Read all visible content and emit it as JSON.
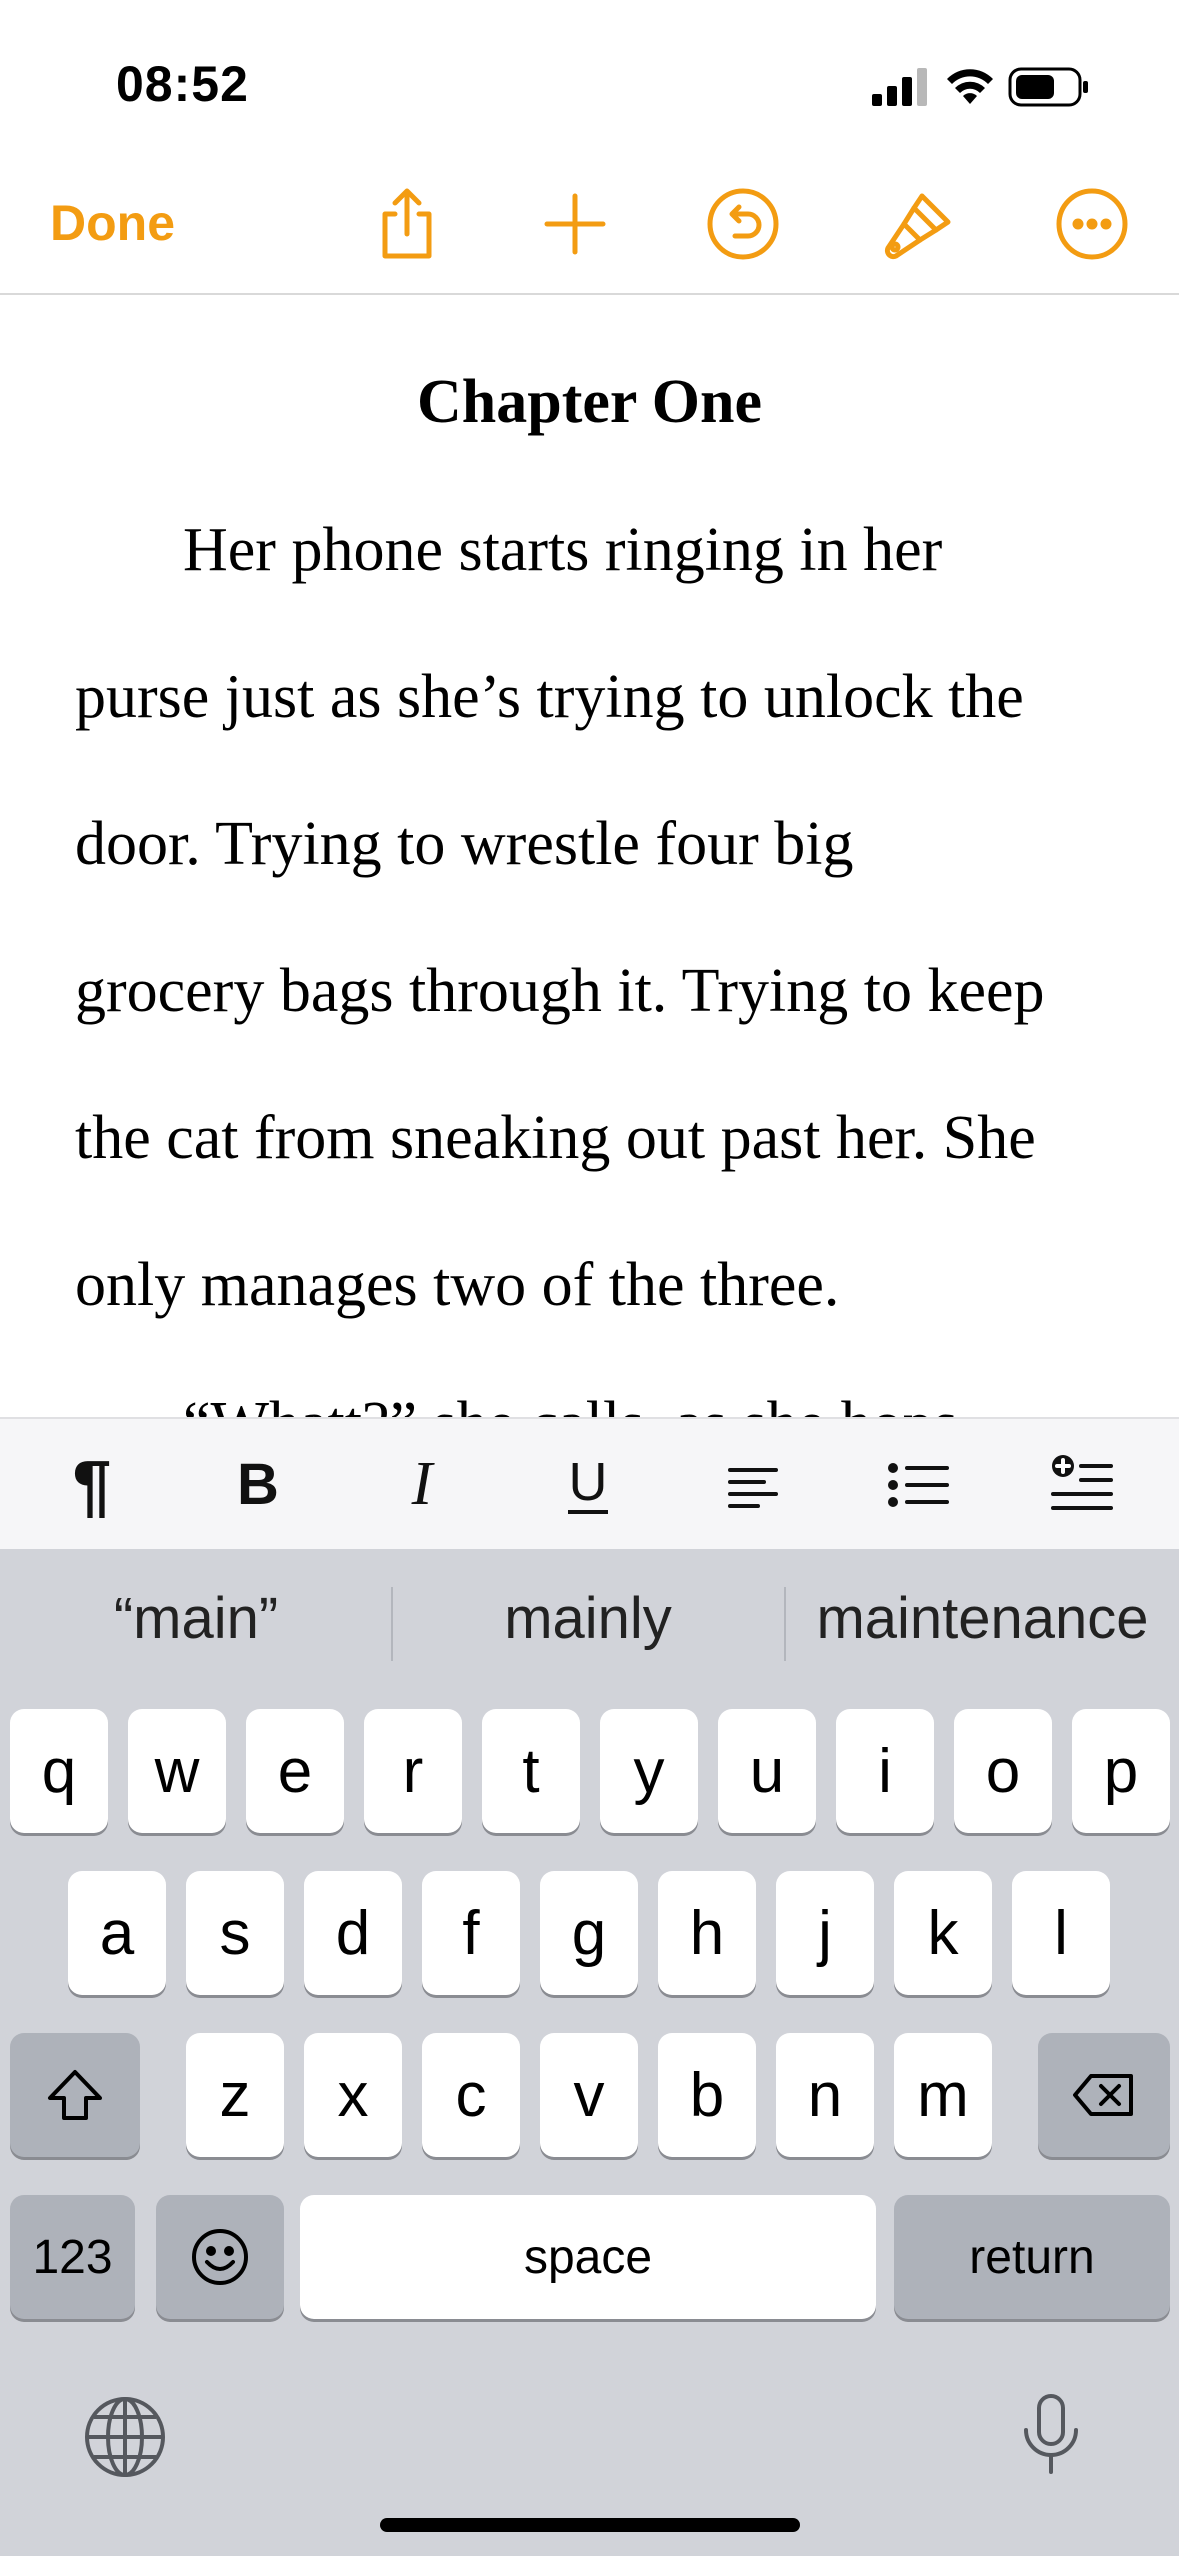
{
  "status_bar": {
    "time": "08:52"
  },
  "toolbar": {
    "done_label": "Done"
  },
  "document": {
    "title": "Chapter One",
    "lines": [
      "Her phone starts ringing in her",
      "purse just as she’s trying to unlock the",
      "door. Trying to wrestle four big",
      "grocery bags through it. Trying to keep",
      "the cat from sneaking out past her. She",
      "only manages two of the three.",
      "“Whatt?” she calls, as she hops"
    ]
  },
  "format_bar": {
    "paragraph_symbol": "¶"
  },
  "keyboard": {
    "predictions": [
      "“main”",
      "mainly",
      "maintenance"
    ],
    "row1": [
      "q",
      "w",
      "e",
      "r",
      "t",
      "y",
      "u",
      "i",
      "o",
      "p"
    ],
    "row2": [
      "a",
      "s",
      "d",
      "f",
      "g",
      "h",
      "j",
      "k",
      "l"
    ],
    "row3": [
      "z",
      "x",
      "c",
      "v",
      "b",
      "n",
      "m"
    ],
    "numbers_label": "123",
    "space_label": "space",
    "return_label": "return"
  },
  "colors": {
    "accent": "#f39c12",
    "keyboard_bg": "#d1d3d9"
  }
}
